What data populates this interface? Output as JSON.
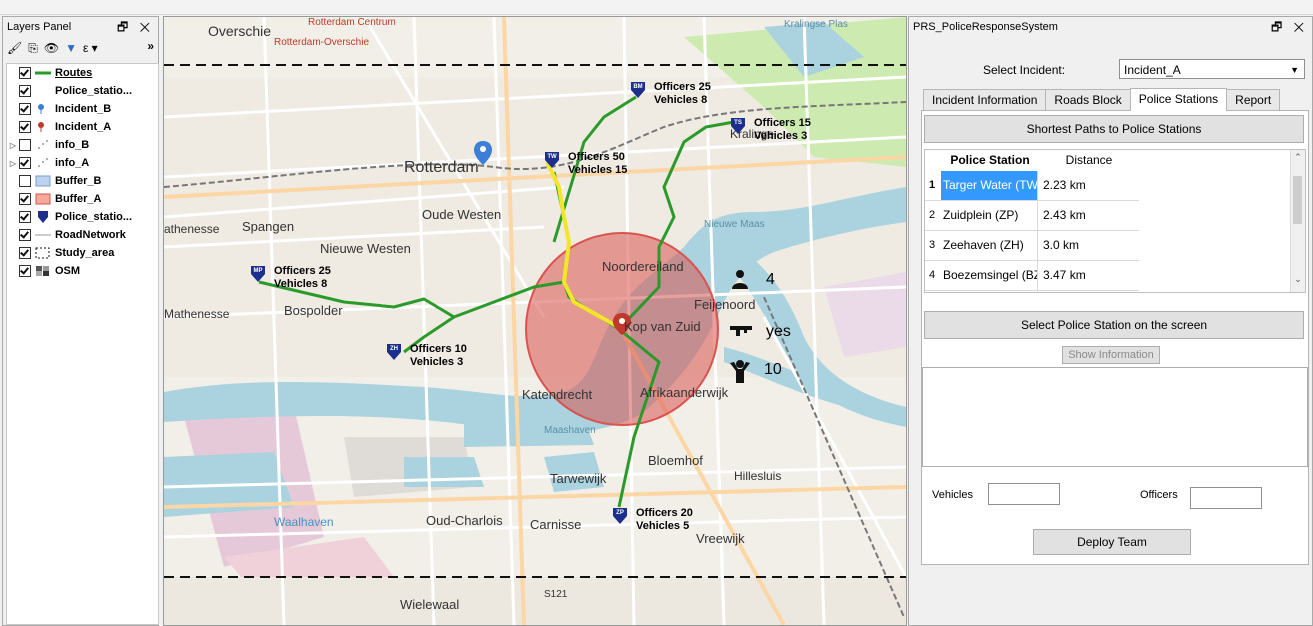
{
  "layers_panel": {
    "title": "Layers Panel",
    "controls": "🗗 ✕",
    "more": "»",
    "layers": [
      {
        "name": "Routes",
        "checked": true,
        "expander": "",
        "symbol": "line-green",
        "selected": true
      },
      {
        "name": "Police_statio...",
        "checked": true,
        "expander": "",
        "symbol": "none"
      },
      {
        "name": "Incident_B",
        "checked": true,
        "expander": "",
        "symbol": "pin-blue"
      },
      {
        "name": "Incident_A",
        "checked": true,
        "expander": "",
        "symbol": "pin-red"
      },
      {
        "name": "info_B",
        "checked": false,
        "expander": "▷",
        "symbol": "dots"
      },
      {
        "name": "info_A",
        "checked": true,
        "expander": "▷",
        "symbol": "dots"
      },
      {
        "name": "Buffer_B",
        "checked": false,
        "expander": "",
        "symbol": "fill-blue"
      },
      {
        "name": "Buffer_A",
        "checked": true,
        "expander": "",
        "symbol": "fill-red"
      },
      {
        "name": "Police_statio...",
        "checked": true,
        "expander": "",
        "symbol": "shield"
      },
      {
        "name": "RoadNetwork",
        "checked": true,
        "expander": "",
        "symbol": "line-gray"
      },
      {
        "name": "Study_area",
        "checked": true,
        "expander": "",
        "symbol": "dashed-box"
      },
      {
        "name": "OSM",
        "checked": true,
        "expander": "",
        "symbol": "raster"
      }
    ]
  },
  "map": {
    "place_labels": [
      {
        "text": "Overschie",
        "size": 14
      },
      {
        "text": "Rotterdam Centrum",
        "size": 10
      },
      {
        "text": "Rotterdam-Overschie",
        "size": 10
      },
      {
        "text": "Kralingse Plas",
        "size": 10
      },
      {
        "text": "Rotterdam",
        "size": 16
      },
      {
        "text": "Oude Westen",
        "size": 13
      },
      {
        "text": "Spangen",
        "size": 13
      },
      {
        "text": "Nieuwe Westen",
        "size": 13
      },
      {
        "text": "athenesse",
        "size": 12
      },
      {
        "text": "Bospolder",
        "size": 13
      },
      {
        "text": "Mathenesse",
        "size": 12
      },
      {
        "text": "Noordereiland",
        "size": 13
      },
      {
        "text": "Feijenoord",
        "size": 13
      },
      {
        "text": "Kop van Zuid",
        "size": 13
      },
      {
        "text": "Katendrecht",
        "size": 13
      },
      {
        "text": "Afrikaanderwijk",
        "size": 13
      },
      {
        "text": "Bloemhof",
        "size": 13
      },
      {
        "text": "Hillesluis",
        "size": 12
      },
      {
        "text": "Tarwewijk",
        "size": 13
      },
      {
        "text": "Carnisse",
        "size": 13
      },
      {
        "text": "Oud-Charlois",
        "size": 13
      },
      {
        "text": "Vreewijk",
        "size": 13
      },
      {
        "text": "Wielewaal",
        "size": 13
      },
      {
        "text": "Waalhaven",
        "size": 12
      },
      {
        "text": "Maashaven",
        "size": 10
      },
      {
        "text": "Nieuwe Maas",
        "size": 10
      },
      {
        "text": "S121",
        "size": 10
      },
      {
        "text": "Kralinge",
        "size": 12
      }
    ],
    "stations": [
      {
        "code": "BM",
        "officers_label": "Officers",
        "officers": "25",
        "vehicles_label": "Vehicles",
        "vehicles": "8"
      },
      {
        "code": "TS",
        "officers_label": "Officers",
        "officers": "15",
        "vehicles_label": "Vehicles",
        "vehicles": "3"
      },
      {
        "code": "TW",
        "officers_label": "Officers",
        "officers": "50",
        "vehicles_label": "Vehicles",
        "vehicles": "15"
      },
      {
        "code": "MP",
        "officers_label": "Officers",
        "officers": "25",
        "vehicles_label": "Vehicles",
        "vehicles": "8"
      },
      {
        "code": "ZH",
        "officers_label": "Officers",
        "officers": "10",
        "vehicles_label": "Vehicles",
        "vehicles": "3"
      },
      {
        "code": "ZP",
        "officers_label": "Officers",
        "officers": "20",
        "vehicles_label": "Vehicles",
        "vehicles": "5"
      }
    ],
    "incident_info": {
      "people": "4",
      "weapon": "yes",
      "hostages": "10"
    },
    "colors": {
      "route": "#2a9a2a",
      "selected_route": "#f3e62a",
      "buffer": "#d9534f",
      "station": "#1d2f8c",
      "water": "#aad3df"
    }
  },
  "prs": {
    "title": "PRS_PoliceResponseSystem",
    "controls": "🗗 ✕",
    "select_incident_label": "Select Incident:",
    "selected_incident": "Incident_A",
    "tabs": [
      "Incident Information",
      "Roads Block",
      "Police Stations",
      "Report"
    ],
    "active_tab": "Police Stations",
    "shortest_paths_button": "Shortest Paths to Police Stations",
    "table": {
      "headers": [
        "Police Station",
        "Distance"
      ],
      "rows": [
        {
          "idx": "1",
          "name": "Targer Water (TW)",
          "distance": "2.23 km"
        },
        {
          "idx": "2",
          "name": "Zuidplein (ZP)",
          "distance": "2.43 km"
        },
        {
          "idx": "3",
          "name": "Zeehaven (ZH)",
          "distance": "3.0 km"
        },
        {
          "idx": "4",
          "name": "Boezemsingel (BZ)",
          "distance": "3.47 km"
        }
      ]
    },
    "select_on_screen_button": "Select Police Station on the screen",
    "show_info_button": "Show Information",
    "vehicles_label": "Vehicles",
    "officers_label": "Officers",
    "vehicles_value": "",
    "officers_value": "",
    "deploy_button": "Deploy Team"
  }
}
